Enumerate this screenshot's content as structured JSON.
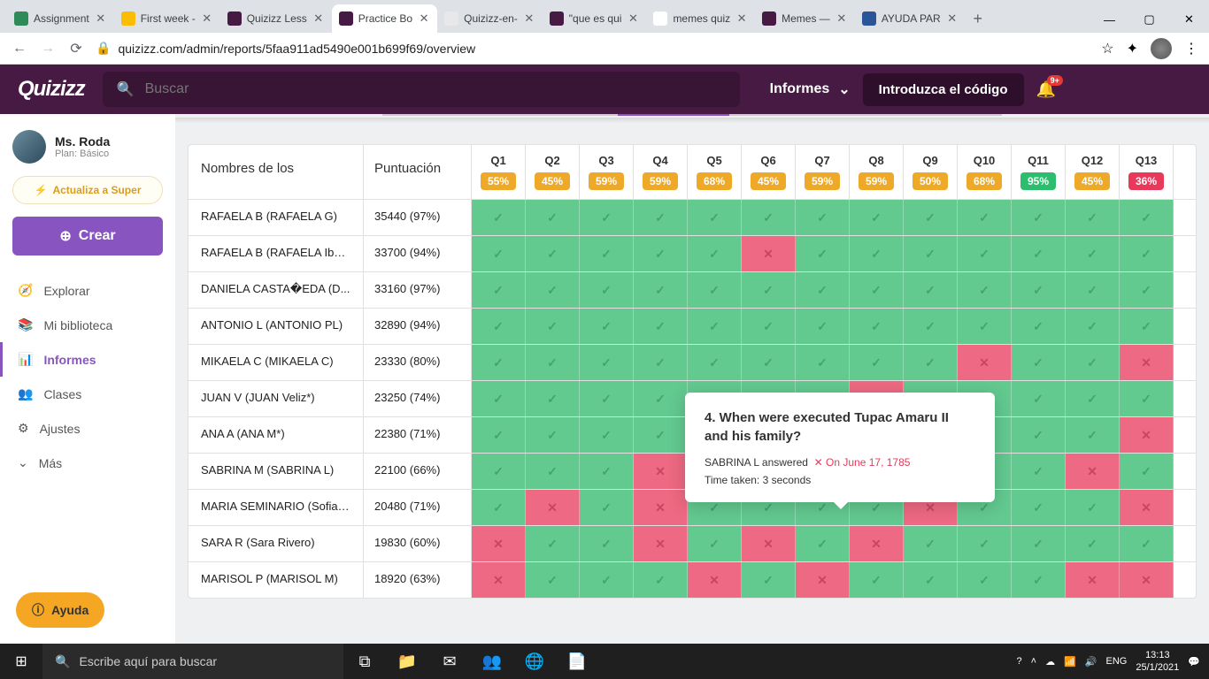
{
  "browser": {
    "tabs": [
      {
        "title": "Assignment",
        "favicon": "#2e8b57"
      },
      {
        "title": "First week -",
        "favicon": "#fbbc04"
      },
      {
        "title": "Quizizz Less",
        "favicon": "#461a42"
      },
      {
        "title": "Practice Bo",
        "favicon": "#461a42",
        "active": true
      },
      {
        "title": "Quizizz-en-",
        "favicon": "#e8e8e8"
      },
      {
        "title": "\"que es qui",
        "favicon": "#461a42"
      },
      {
        "title": "memes quiz",
        "favicon": "#fff"
      },
      {
        "title": "Memes —",
        "favicon": "#461a42"
      },
      {
        "title": "AYUDA PAR",
        "favicon": "#2a5699"
      }
    ],
    "url": "quizizz.com/admin/reports/5faa911ad5490e001b699f69/overview"
  },
  "header": {
    "logo": "Quizizz",
    "search_placeholder": "Buscar",
    "dropdown": "Informes",
    "enter_code": "Introduzca el código",
    "badge": "9+"
  },
  "sidebar": {
    "user_name": "Ms. Roda",
    "user_plan": "Plan: Básico",
    "upgrade": "Actualiza a Super",
    "create": "Crear",
    "items": [
      {
        "label": "Explorar",
        "icon": "🧭"
      },
      {
        "label": "Mi biblioteca",
        "icon": "📚"
      },
      {
        "label": "Informes",
        "icon": "📊",
        "active": true
      },
      {
        "label": "Clases",
        "icon": "👥"
      },
      {
        "label": "Ajustes",
        "icon": "⚙"
      },
      {
        "label": "Más",
        "icon": "⌄"
      }
    ]
  },
  "table": {
    "header_names": "Nombres de los",
    "header_score": "Puntuación",
    "questions": [
      {
        "label": "Q1",
        "pct": "55%",
        "color": "orange"
      },
      {
        "label": "Q2",
        "pct": "45%",
        "color": "orange"
      },
      {
        "label": "Q3",
        "pct": "59%",
        "color": "orange"
      },
      {
        "label": "Q4",
        "pct": "59%",
        "color": "orange"
      },
      {
        "label": "Q5",
        "pct": "68%",
        "color": "orange"
      },
      {
        "label": "Q6",
        "pct": "45%",
        "color": "orange"
      },
      {
        "label": "Q7",
        "pct": "59%",
        "color": "orange"
      },
      {
        "label": "Q8",
        "pct": "59%",
        "color": "orange"
      },
      {
        "label": "Q9",
        "pct": "50%",
        "color": "orange"
      },
      {
        "label": "Q10",
        "pct": "68%",
        "color": "orange"
      },
      {
        "label": "Q11",
        "pct": "95%",
        "color": "green"
      },
      {
        "label": "Q12",
        "pct": "45%",
        "color": "orange"
      },
      {
        "label": "Q13",
        "pct": "36%",
        "color": "red"
      }
    ],
    "rows": [
      {
        "name": "RAFAELA B (RAFAELA G)",
        "score": "35440 (97%)",
        "cells": [
          1,
          1,
          1,
          1,
          1,
          1,
          1,
          1,
          1,
          1,
          1,
          1,
          1
        ]
      },
      {
        "name": "RAFAELA B (RAFAELA Ibar...",
        "score": "33700 (94%)",
        "cells": [
          1,
          1,
          1,
          1,
          1,
          0,
          1,
          1,
          1,
          1,
          1,
          1,
          1
        ]
      },
      {
        "name": "DANIELA CASTA�EDA (D...",
        "score": "33160 (97%)",
        "cells": [
          1,
          1,
          1,
          1,
          1,
          1,
          1,
          1,
          1,
          1,
          1,
          1,
          1
        ]
      },
      {
        "name": "ANTONIO L (ANTONIO PL)",
        "score": "32890 (94%)",
        "cells": [
          1,
          1,
          1,
          1,
          1,
          1,
          1,
          1,
          1,
          1,
          1,
          1,
          1
        ]
      },
      {
        "name": "MIKAELA C (MIKAELA C)",
        "score": "23330 (80%)",
        "cells": [
          1,
          1,
          1,
          1,
          1,
          1,
          1,
          1,
          1,
          0,
          1,
          1,
          0
        ]
      },
      {
        "name": "JUAN V (JUAN Veliz*)",
        "score": "23250 (74%)",
        "cells": [
          1,
          1,
          1,
          1,
          1,
          1,
          1,
          0,
          1,
          1,
          1,
          1,
          1
        ]
      },
      {
        "name": "ANA A (ANA M*)",
        "score": "22380 (71%)",
        "cells": [
          1,
          1,
          1,
          1,
          1,
          1,
          1,
          0,
          0,
          1,
          1,
          1,
          0
        ]
      },
      {
        "name": "SABRINA M (SABRINA L)",
        "score": "22100 (66%)",
        "cells": [
          1,
          1,
          1,
          0,
          1,
          0,
          0,
          1,
          1,
          1,
          1,
          0,
          1
        ]
      },
      {
        "name": "MARIA SEMINARIO (Sofia ...",
        "score": "20480 (71%)",
        "cells": [
          1,
          0,
          1,
          0,
          1,
          1,
          1,
          1,
          0,
          1,
          1,
          1,
          0
        ]
      },
      {
        "name": "SARA R (Sara Rivero)",
        "score": "19830 (60%)",
        "cells": [
          0,
          1,
          1,
          0,
          1,
          0,
          1,
          0,
          1,
          1,
          1,
          1,
          1
        ]
      },
      {
        "name": "MARISOL P (MARISOL M)",
        "score": "18920 (63%)",
        "cells": [
          0,
          1,
          1,
          1,
          0,
          1,
          0,
          1,
          1,
          1,
          1,
          0,
          0
        ]
      }
    ]
  },
  "tooltip": {
    "question": "4. When were executed Tupac Amaru II and his family?",
    "answered_by": "SABRINA L answered",
    "answer": "On June 17, 1785",
    "time_label": "Time taken: 3 seconds"
  },
  "help_btn": "Ayuda",
  "taskbar": {
    "search": "Escribe aquí para buscar",
    "lang": "ENG",
    "time": "13:13",
    "date": "25/1/2021"
  }
}
